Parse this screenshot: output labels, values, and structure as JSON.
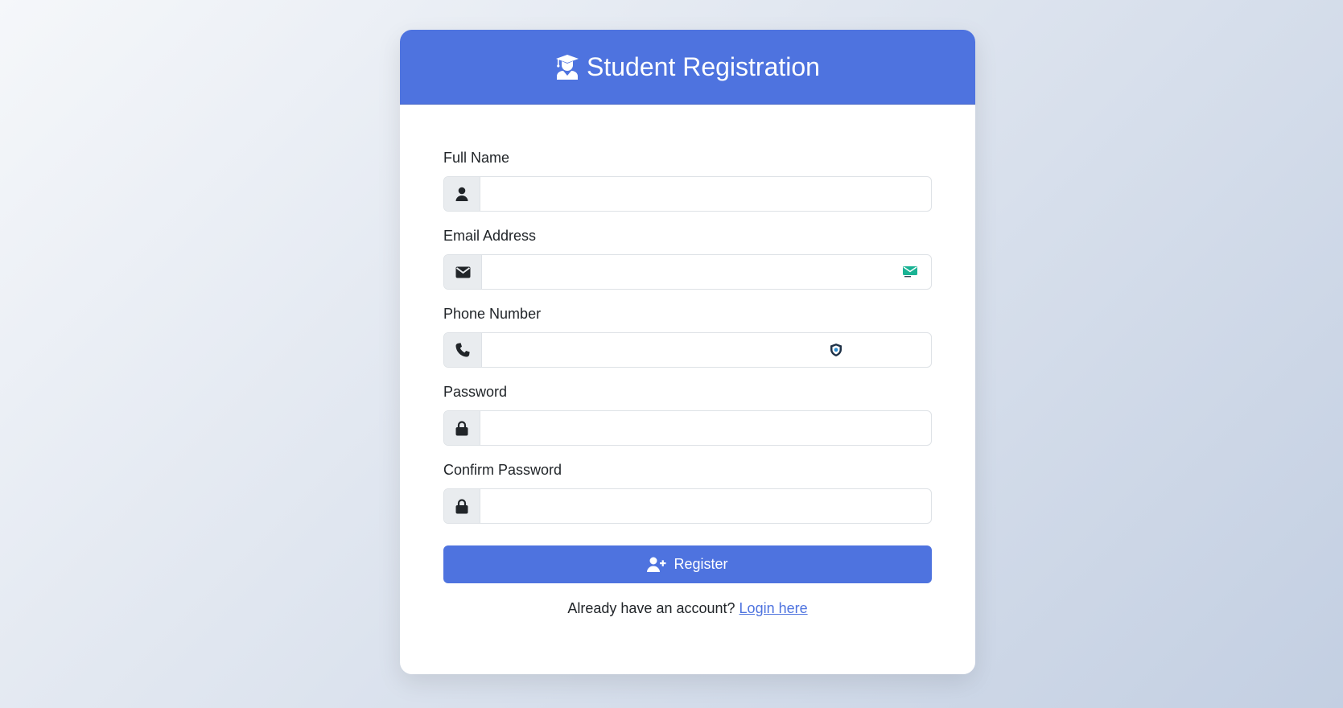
{
  "header": {
    "title": "Student Registration",
    "icon": "user-graduate-icon",
    "color": "#4e73df"
  },
  "form": {
    "fields": [
      {
        "label": "Full Name",
        "icon": "user-icon",
        "value": "",
        "placeholder": ""
      },
      {
        "label": "Email Address",
        "icon": "envelope-icon",
        "value": "",
        "placeholder": ""
      },
      {
        "label": "Phone Number",
        "icon": "phone-icon",
        "value": "",
        "placeholder": ""
      },
      {
        "label": "Password",
        "icon": "lock-icon",
        "value": "",
        "placeholder": ""
      },
      {
        "label": "Confirm Password",
        "icon": "lock-icon",
        "value": "",
        "placeholder": ""
      }
    ],
    "submit_label": "Register",
    "submit_icon": "user-plus-icon"
  },
  "footer": {
    "prompt": "Already have an account?",
    "link_label": "Login here"
  },
  "colors": {
    "primary": "#4e73df",
    "background_start": "#f5f7fa",
    "background_end": "#c3cfe2"
  }
}
